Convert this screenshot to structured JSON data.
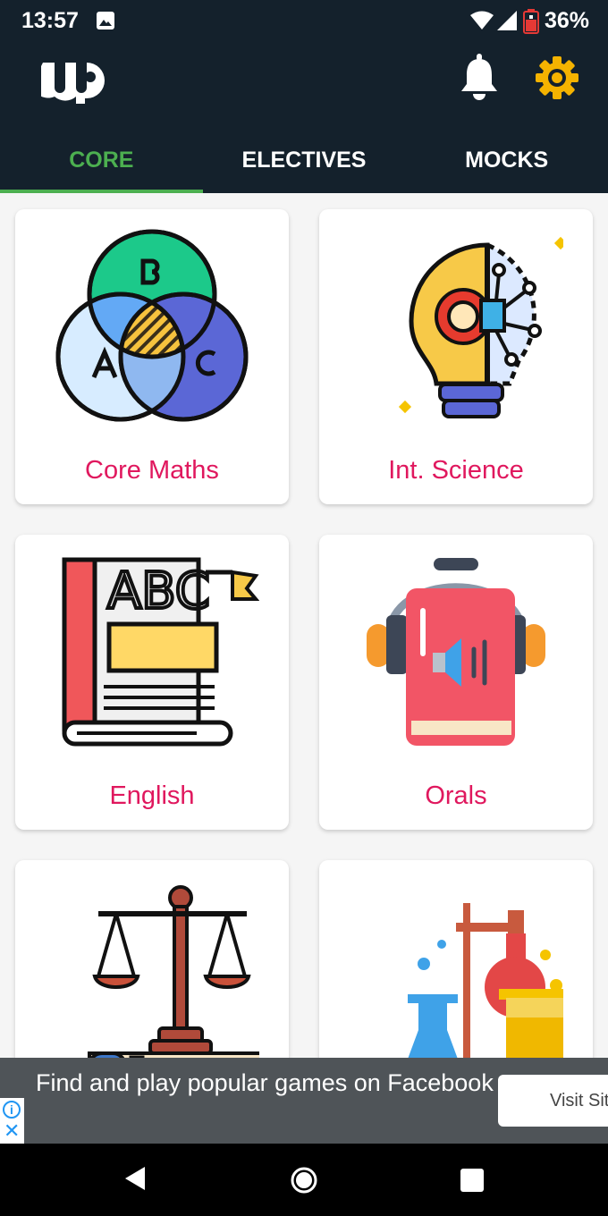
{
  "status_bar": {
    "time": "13:57",
    "battery": "36%",
    "icons": [
      "image-icon",
      "wifi-icon",
      "cellular-signal-icon",
      "battery-low-icon"
    ]
  },
  "app_bar": {
    "logo": "WP",
    "icons": [
      "notifications-bell-icon",
      "settings-gear-icon"
    ],
    "accent_colors": {
      "bar_bg": "#14212c",
      "active_tab": "#4caf50",
      "card_label": "#e0185e"
    }
  },
  "tabs": [
    {
      "label": "CORE",
      "active": true
    },
    {
      "label": "ELECTIVES",
      "active": false
    },
    {
      "label": "MOCKS",
      "active": false
    }
  ],
  "subjects": [
    {
      "label": "Core Maths",
      "icon": "venn-diagram-icon"
    },
    {
      "label": "Int. Science",
      "icon": "lightbulb-gear-circuit-icon"
    },
    {
      "label": "English",
      "icon": "abc-book-icon"
    },
    {
      "label": "Orals",
      "icon": "audiobook-headphones-icon"
    },
    {
      "label": "",
      "icon": "scales-of-justice-icon"
    },
    {
      "label": "",
      "icon": "lab-flasks-icon"
    }
  ],
  "ad_banner": {
    "text": "Find and play popular games on Facebook, both on desktop and mobile…",
    "button": "Visit Sit"
  },
  "nav_bar": {
    "icons": [
      "back-triangle-icon",
      "home-circle-icon",
      "recents-square-icon"
    ]
  }
}
